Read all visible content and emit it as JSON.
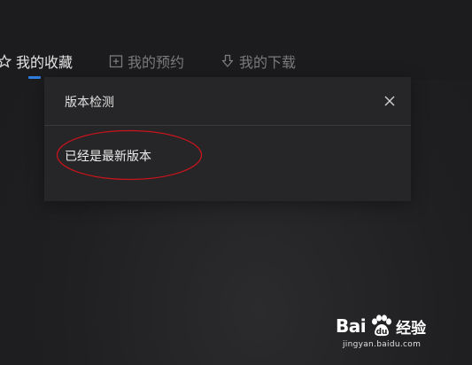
{
  "tabs": [
    {
      "label": "我的收藏",
      "icon": "star-icon",
      "active": true
    },
    {
      "label": "我的预约",
      "icon": "calendar-plus-icon",
      "active": false
    },
    {
      "label": "我的下载",
      "icon": "download-icon",
      "active": false
    }
  ],
  "dialog": {
    "title": "版本检测",
    "message": "已经是最新版本",
    "close_icon": "close-icon"
  },
  "watermark": {
    "brand_left": "Bai",
    "brand_right": "u",
    "brand_cn": "经验",
    "url": "jingyan.baidu.com"
  },
  "colors": {
    "accent": "#2f7ee0",
    "annotation": "#c8141c"
  }
}
